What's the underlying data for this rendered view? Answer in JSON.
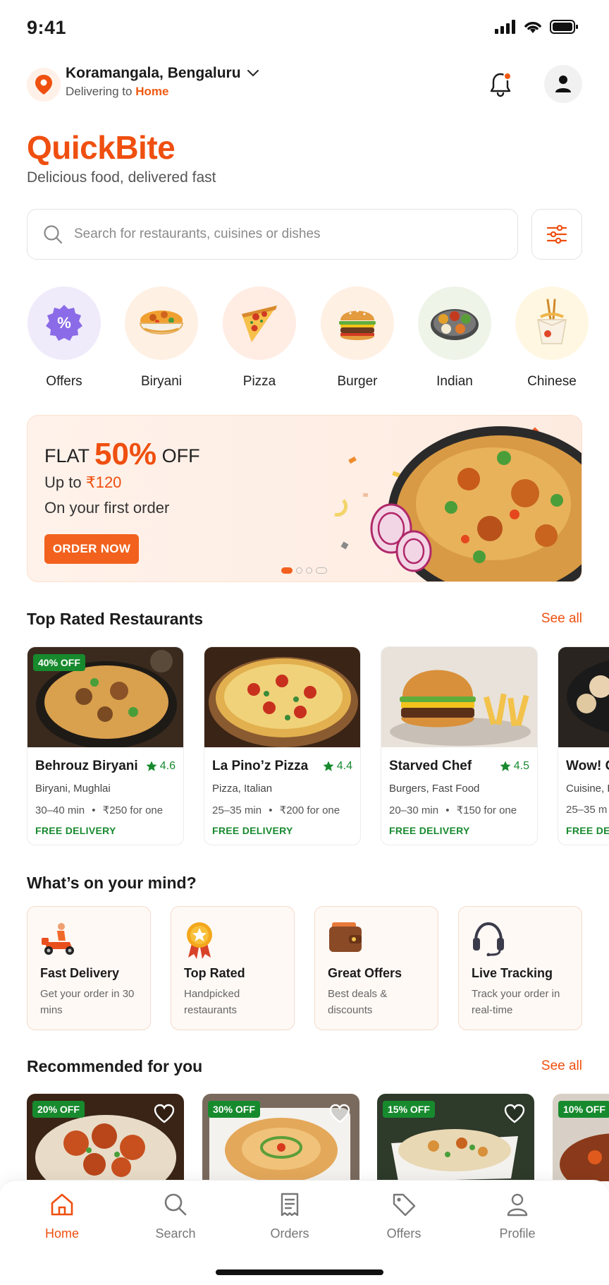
{
  "status_bar": {
    "time": "9:41"
  },
  "header": {
    "city": "Koramangala, Bengaluru",
    "delivering_prefix": "Delivering to",
    "delivering_target": "Home"
  },
  "brand": {
    "name": "QuickBite",
    "tagline": "Delicious food, delivered fast"
  },
  "search": {
    "placeholder": "Search for restaurants, cuisines or dishes"
  },
  "categories": [
    {
      "label": "Offers",
      "icon": "offers-badge-icon"
    },
    {
      "label": "Biryani",
      "icon": "biryani-icon"
    },
    {
      "label": "Pizza",
      "icon": "pizza-icon"
    },
    {
      "label": "Burger",
      "icon": "burger-icon"
    },
    {
      "label": "Indian",
      "icon": "indian-thali-icon"
    },
    {
      "label": "Chinese",
      "icon": "chinese-noodles-icon"
    }
  ],
  "promo": {
    "flat": "FLAT",
    "percent": "50%",
    "off": "OFF",
    "upto_prefix": "Up to",
    "upto_amount": "₹120",
    "subtitle": "On your first order",
    "cta": "ORDER NOW",
    "slides": 4,
    "active_slide": 1
  },
  "top_rated": {
    "title": "Top Rated Restaurants",
    "see_all": "See all",
    "restaurants": [
      {
        "badge": "40% OFF",
        "name": "Behrouz Biryani",
        "rating": "4.6",
        "cuisine": "Biryani, Mughlai",
        "time": "30–40 min",
        "price": "₹250 for one",
        "delivery": "FREE DELIVERY"
      },
      {
        "badge": "",
        "name": "La Pino’z Pizza",
        "rating": "4.4",
        "cuisine": "Pizza, Italian",
        "time": "25–35 min",
        "price": "₹200 for one",
        "delivery": "FREE DELIVERY"
      },
      {
        "badge": "",
        "name": "Starved Chef",
        "rating": "4.5",
        "cuisine": "Burgers, Fast Food",
        "time": "20–30 min",
        "price": "₹150 for one",
        "delivery": "FREE DELIVERY"
      },
      {
        "badge": "",
        "name": "Wow! C",
        "rating": "",
        "cuisine": "Cuisine, F",
        "time": "25–35 m",
        "price": "",
        "delivery": "FREE DEL"
      }
    ]
  },
  "mind": {
    "title": "What’s on your mind?",
    "items": [
      {
        "title": "Fast Delivery",
        "desc": "Get your order in 30 mins",
        "icon": "scooter-icon"
      },
      {
        "title": "Top Rated",
        "desc": "Handpicked restaurants",
        "icon": "award-ribbon-icon"
      },
      {
        "title": "Great Offers",
        "desc": "Best deals & discounts",
        "icon": "wallet-icon"
      },
      {
        "title": "Live Tracking",
        "desc": "Track your order in real-time",
        "icon": "headset-icon"
      }
    ]
  },
  "recommended": {
    "title": "Recommended for you",
    "see_all": "See all",
    "items": [
      {
        "badge": "20% OFF"
      },
      {
        "badge": "30% OFF"
      },
      {
        "badge": "15% OFF"
      },
      {
        "badge": "10% OFF"
      }
    ]
  },
  "bottom_nav": [
    {
      "label": "Home",
      "icon": "home-icon",
      "active": true
    },
    {
      "label": "Search",
      "icon": "search-icon",
      "active": false
    },
    {
      "label": "Orders",
      "icon": "receipt-icon",
      "active": false
    },
    {
      "label": "Offers",
      "icon": "tag-icon",
      "active": false
    },
    {
      "label": "Profile",
      "icon": "person-icon",
      "active": false
    }
  ],
  "colors": {
    "accent": "#ef4f0f",
    "success": "#178a2e",
    "banner_bg": "#fff2ea"
  }
}
